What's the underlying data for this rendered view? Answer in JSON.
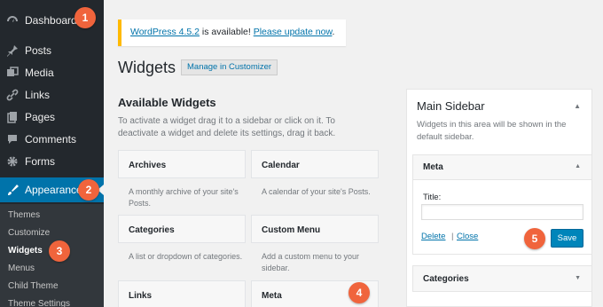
{
  "sidebar": {
    "items": [
      {
        "label": "Dashboard",
        "icon": "dashboard-icon"
      },
      {
        "label": "Posts",
        "icon": "pin-icon"
      },
      {
        "label": "Media",
        "icon": "media-icon"
      },
      {
        "label": "Links",
        "icon": "link-icon"
      },
      {
        "label": "Pages",
        "icon": "pages-icon"
      },
      {
        "label": "Comments",
        "icon": "comment-icon"
      },
      {
        "label": "Forms",
        "icon": "gear-icon"
      },
      {
        "label": "Appearance",
        "icon": "brush-icon"
      }
    ],
    "submenu": [
      "Themes",
      "Customize",
      "Widgets",
      "Menus",
      "Child Theme",
      "Theme Settings"
    ]
  },
  "badges": [
    "1",
    "2",
    "3",
    "4",
    "5"
  ],
  "notice": {
    "version_link": "WordPress 4.5.2",
    "middle": " is available! ",
    "update_link": "Please update now",
    "end": "."
  },
  "page": {
    "title": "Widgets",
    "manage_button": "Manage in Customizer"
  },
  "available": {
    "title": "Available Widgets",
    "description": "To activate a widget drag it to a sidebar or click on it. To deactivate a widget and delete its settings, drag it back.",
    "widgets": [
      {
        "name": "Archives",
        "desc": "A monthly archive of your site's Posts."
      },
      {
        "name": "Calendar",
        "desc": "A calendar of your site's Posts."
      },
      {
        "name": "Categories",
        "desc": "A list or dropdown of categories."
      },
      {
        "name": "Custom Menu",
        "desc": "Add a custom menu to your sidebar."
      },
      {
        "name": "Links",
        "desc": ""
      },
      {
        "name": "Meta",
        "desc": ""
      }
    ]
  },
  "main_sidebar": {
    "title": "Main Sidebar",
    "description": "Widgets in this area will be shown in the default sidebar.",
    "meta_widget": {
      "title": "Meta",
      "field_label": "Title:",
      "field_value": "",
      "delete_label": "Delete",
      "separator": "|",
      "close_label": "Close",
      "save_label": "Save"
    },
    "categories_widget": {
      "title": "Categories"
    }
  },
  "colors": {
    "accent": "#0073aa",
    "sidebar_bg": "#23282d",
    "badge": "#f0643c",
    "notice_border": "#ffb900",
    "save_button": "#0085ba"
  }
}
